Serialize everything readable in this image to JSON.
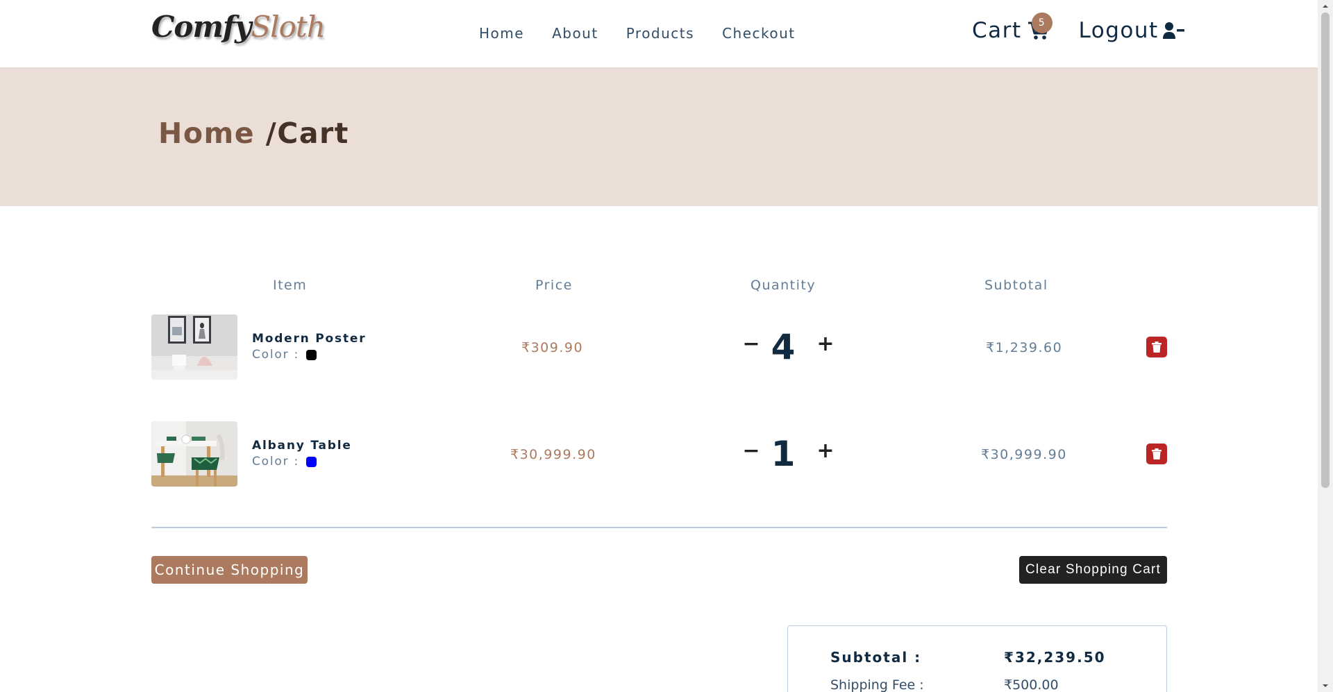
{
  "nav": {
    "logo_part1": "Comfy",
    "logo_part2": "Sloth",
    "links": [
      "Home",
      "About",
      "Products",
      "Checkout"
    ],
    "cart_label": "Cart",
    "cart_count": "5",
    "logout_label": "Logout"
  },
  "hero": {
    "crumb_home": "Home",
    "crumb_current": " /Cart"
  },
  "table": {
    "headers": [
      "Item",
      "Price",
      "Quantity",
      "Subtotal"
    ],
    "rows": [
      {
        "name": "Modern Poster",
        "color_label": "Color :",
        "color": "#000000",
        "price": "₹309.90",
        "qty": "4",
        "minus": "−",
        "plus": "+",
        "subtotal": "₹1,239.60"
      },
      {
        "name": "Albany Table",
        "color_label": "Color :",
        "color": "#0000ff",
        "price": "₹30,999.90",
        "qty": "1",
        "minus": "−",
        "plus": "+",
        "subtotal": "₹30,999.90"
      }
    ]
  },
  "actions": {
    "continue_label": "Continue Shopping",
    "clear_label": "Clear Shopping Cart"
  },
  "totals": {
    "subtotal_label": "Subtotal :",
    "subtotal_value": "₹32,239.50",
    "shipping_label": "Shipping Fee :",
    "shipping_value": "₹500.00"
  },
  "colors": {
    "brand": "#ab7a5f",
    "hero_bg": "#eaded7",
    "delete": "#bb2525",
    "dark": "#222222"
  }
}
